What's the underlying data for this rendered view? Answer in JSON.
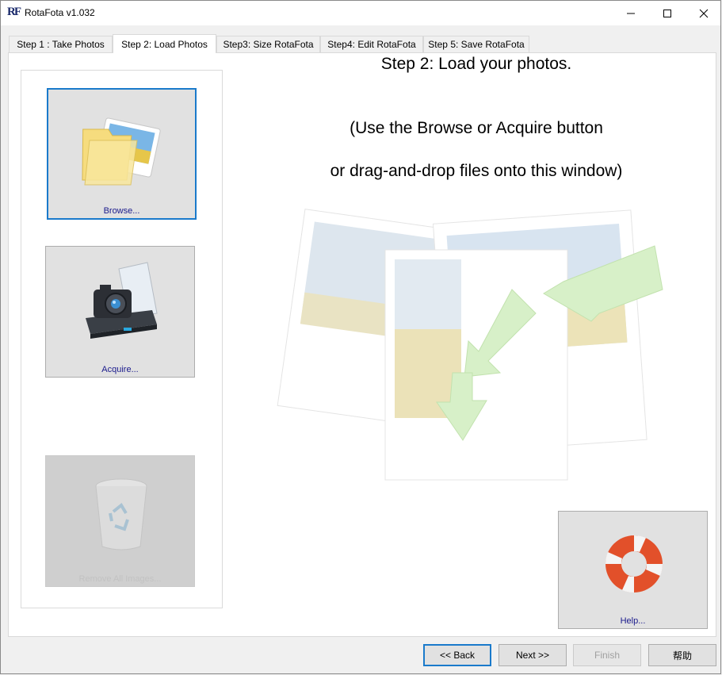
{
  "window": {
    "title": "RotaFota v1.032",
    "app_icon": "RF"
  },
  "tabs": [
    {
      "label": "Step 1 : Take Photos"
    },
    {
      "label": "Step 2: Load Photos"
    },
    {
      "label": "Step3: Size RotaFota"
    },
    {
      "label": "Step4: Edit RotaFota"
    },
    {
      "label": "Step 5: Save RotaFota"
    }
  ],
  "main": {
    "heading": "Step 2: Load your photos.",
    "instruction_line1": "(Use the Browse or Acquire button",
    "instruction_line2": "or drag-and-drop files onto this window)"
  },
  "sidebar": {
    "browse_label": "Browse...",
    "acquire_label": "Acquire...",
    "remove_label": "Remove All Images..."
  },
  "help_label": "Help...",
  "footer": {
    "back_label": "<< Back",
    "next_label": "Next >>",
    "finish_label": "Finish",
    "help_label": "帮助"
  }
}
